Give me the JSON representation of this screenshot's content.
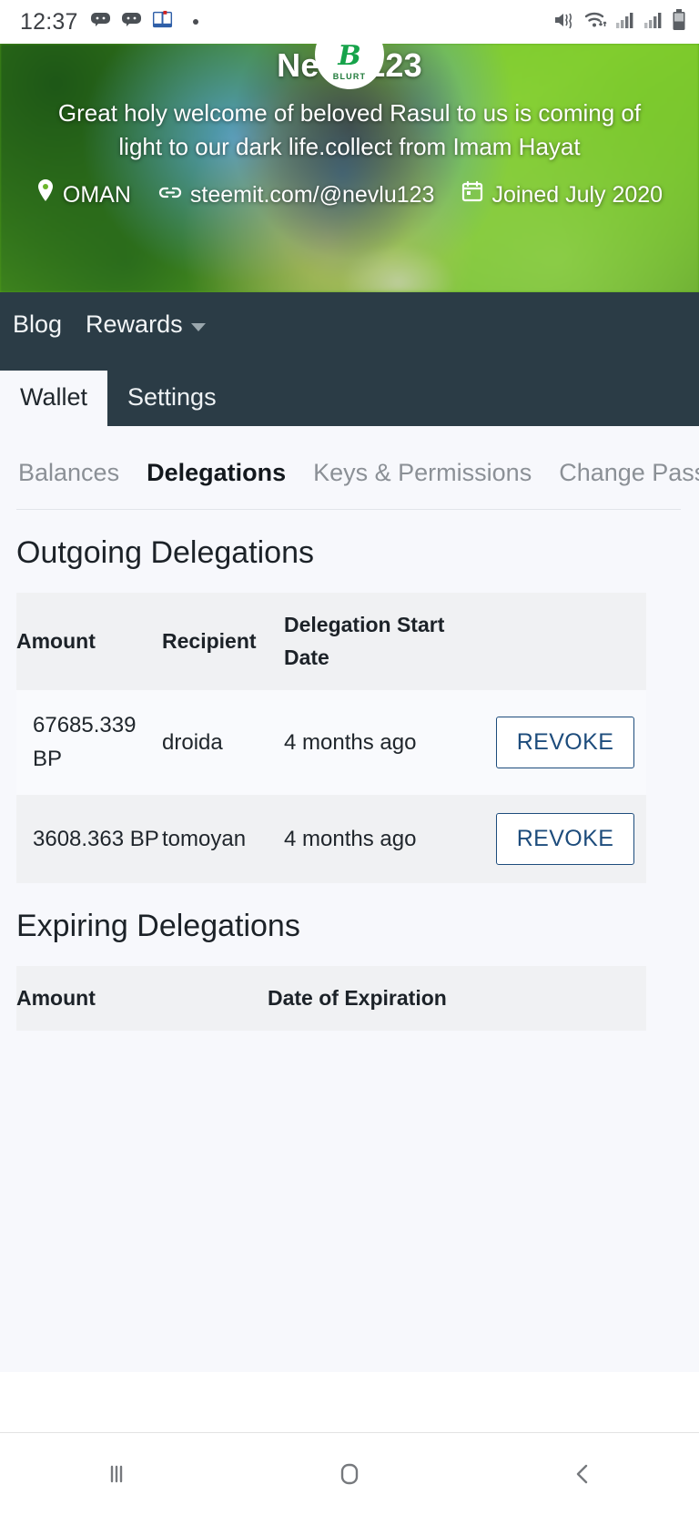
{
  "status_bar": {
    "time": "12:37",
    "left_icons": [
      "game-chat-icon",
      "game-chat-icon",
      "dictionary-book-icon",
      "dot-indicator"
    ],
    "right_icons": [
      "mute-vibrate-icon",
      "wifi-icon",
      "signal-sim1-icon",
      "signal-sim2-icon",
      "battery-icon"
    ]
  },
  "profile": {
    "avatar_mark": "B",
    "avatar_word": "BLURT",
    "username": "Nevlu123",
    "bio": "Great holy welcome of beloved Rasul to us is coming of light to our dark life.collect from Imam Hayat",
    "location": "OMAN",
    "website": "steemit.com/@nevlu123",
    "joined": "Joined July 2020"
  },
  "nav": {
    "links": [
      {
        "label": "Blog",
        "has_caret": false
      },
      {
        "label": "Rewards",
        "has_caret": true
      }
    ],
    "tabs": [
      {
        "label": "Wallet",
        "active": true
      },
      {
        "label": "Settings",
        "active": false
      }
    ]
  },
  "subtabs": [
    {
      "label": "Balances",
      "active": false
    },
    {
      "label": "Delegations",
      "active": true
    },
    {
      "label": "Keys & Permissions",
      "active": false
    },
    {
      "label": "Change Pass",
      "active": false
    }
  ],
  "outgoing": {
    "title": "Outgoing Delegations",
    "headers": {
      "amount": "Amount",
      "recipient": "Recipient",
      "date": "Delegation Start Date"
    },
    "rows": [
      {
        "amount": "67685.339 BP",
        "recipient": "droida",
        "date": "4 months ago",
        "action": "REVOKE"
      },
      {
        "amount": "3608.363 BP",
        "recipient": "tomoyan",
        "date": "4 months ago",
        "action": "REVOKE"
      }
    ]
  },
  "expiring": {
    "title": "Expiring Delegations",
    "headers": {
      "amount": "Amount",
      "date": "Date of Expiration"
    },
    "rows": []
  },
  "system_nav": {
    "recents": "recents-icon",
    "home": "home-icon",
    "back": "back-icon"
  },
  "colors": {
    "nav_bg": "#2b3c46",
    "page_bg": "#f7f8fc",
    "accent_blue": "#1d4c7c",
    "header_row": "#f0f1f3"
  }
}
